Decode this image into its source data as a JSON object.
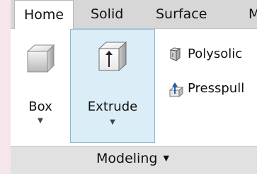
{
  "tabs": [
    {
      "label": "Home",
      "active": true
    },
    {
      "label": "Solid",
      "active": false
    },
    {
      "label": "Surface",
      "active": false
    },
    {
      "label": "M",
      "active": false
    }
  ],
  "panel": {
    "title": "Modeling",
    "title_icon": "dropdown-arrow-icon",
    "big_buttons": [
      {
        "label": "Box",
        "icon": "box-icon",
        "dropdown_icon": "caret-down-icon"
      },
      {
        "label": "Extrude",
        "icon": "extrude-icon",
        "dropdown_icon": "caret-down-icon",
        "highlighted": true
      }
    ],
    "small_buttons": [
      {
        "label": "Polysolic",
        "icon": "polysolid-icon"
      },
      {
        "label": "Presspull",
        "icon": "presspull-icon"
      }
    ]
  },
  "colors": {
    "highlight_bg": "#dbeef8",
    "highlight_border": "#82b8d8",
    "page_bg": "#f6e6ea"
  }
}
